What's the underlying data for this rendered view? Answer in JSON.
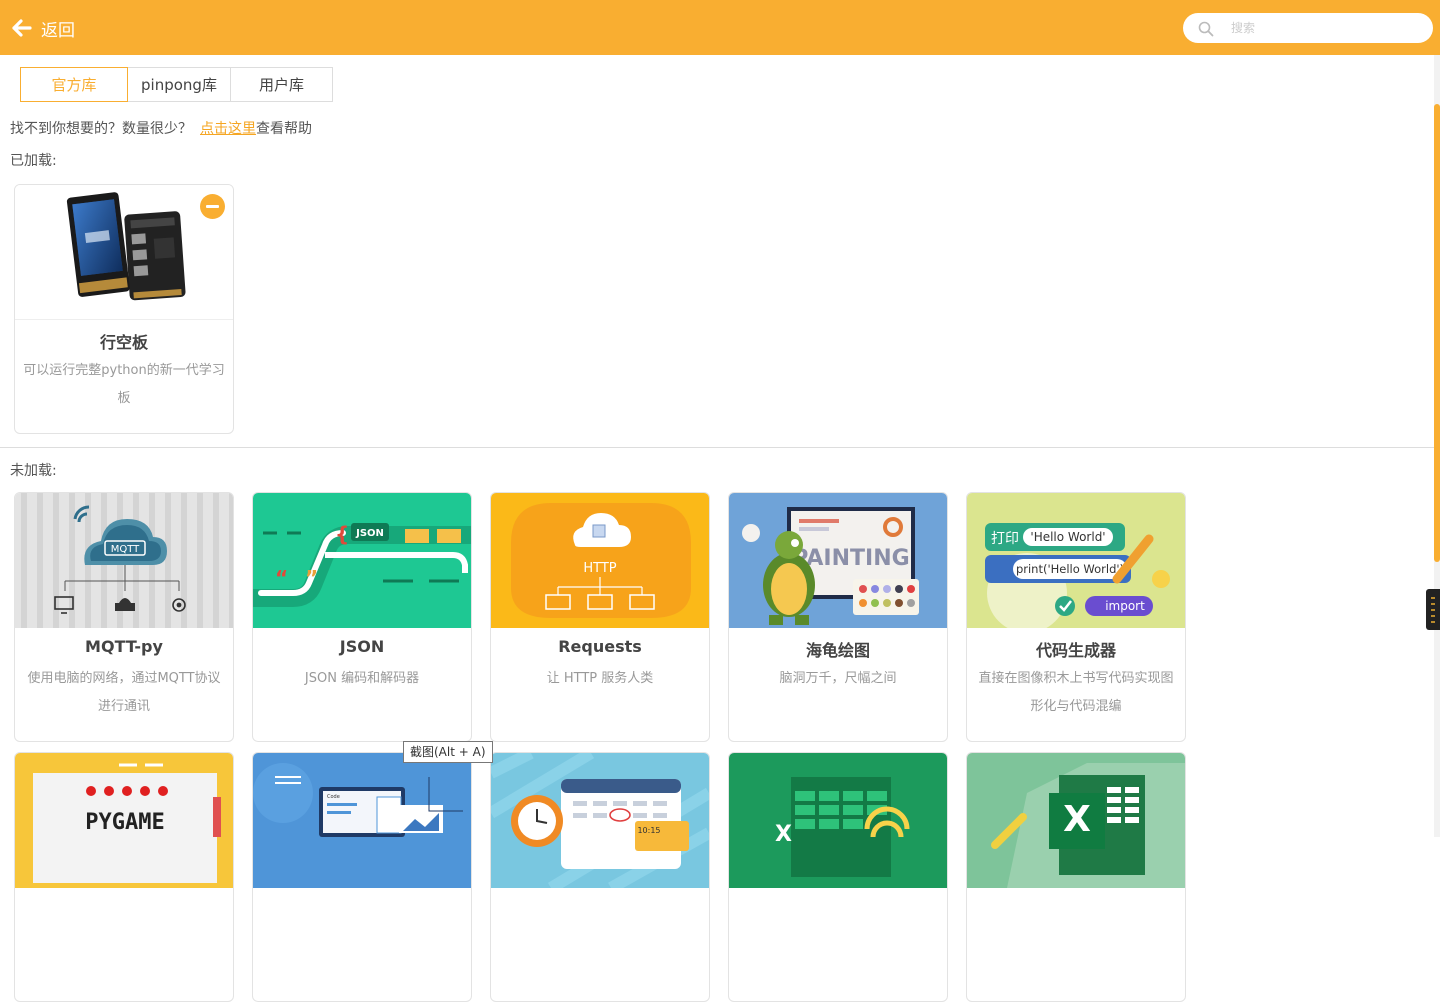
{
  "header": {
    "back_label": "返回",
    "search_placeholder": "搜索"
  },
  "tabs": [
    {
      "label": "官方库",
      "active": true
    },
    {
      "label": "pinpong库",
      "active": false
    },
    {
      "label": "用户库",
      "active": false
    }
  ],
  "help": {
    "prefix": "找不到你想要的？数量很少？",
    "link": "点击这里",
    "suffix": "查看帮助"
  },
  "loaded_section": {
    "label": "已加载:",
    "items": [
      {
        "title": "行空板",
        "description": "可以运行完整python的新一代学习板",
        "icon": "unihiker-board-image"
      }
    ]
  },
  "unloaded_section": {
    "label": "未加载:",
    "items": [
      {
        "title": "MQTT-py",
        "description": "使用电脑的网络，通过MQTT协议进行通讯",
        "icon": "mqtt-cloud-image",
        "image_text": "MQTT"
      },
      {
        "title": "JSON",
        "description": "JSON 编码和解码器",
        "icon": "json-image",
        "image_text": "JSON"
      },
      {
        "title": "Requests",
        "description": "让 HTTP 服务人类",
        "icon": "http-cloud-image",
        "image_text": "HTTP"
      },
      {
        "title": "海龟绘图",
        "description": "脑洞万千，尺幅之间",
        "icon": "turtle-painting-image",
        "image_text": "PAINTING"
      },
      {
        "title": "代码生成器",
        "description": "直接在图像积木上书写代码实现图形化与代码混编",
        "icon": "code-generator-image",
        "image_text": [
          "打印",
          "'Hello World'",
          "print('Hello World')",
          "import"
        ]
      },
      {
        "title": "",
        "description": "",
        "icon": "pygame-image",
        "image_text": "PYGAME"
      },
      {
        "title": "",
        "description": "",
        "icon": "gui-designer-image",
        "image_text": "Code"
      },
      {
        "title": "",
        "description": "",
        "icon": "calendar-clock-image",
        "image_text": "10:15"
      },
      {
        "title": "",
        "description": "",
        "icon": "excel-wifi-image",
        "image_text": "X"
      },
      {
        "title": "",
        "description": "",
        "icon": "excel-image",
        "image_text": "X"
      }
    ]
  },
  "tooltip": "截图(Alt + A)",
  "colors": {
    "accent": "#f9ae31",
    "link": "#f5a623"
  }
}
